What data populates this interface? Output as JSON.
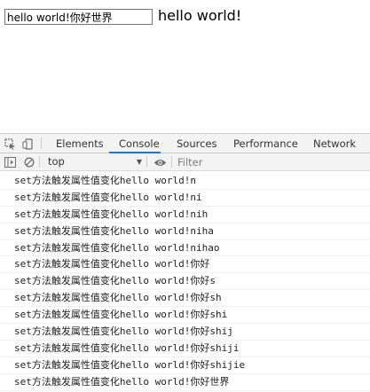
{
  "page": {
    "input_value": "hello world!你好世界",
    "echo_text": "hello world!"
  },
  "devtools": {
    "tabs": [
      {
        "label": "Elements",
        "active": false
      },
      {
        "label": "Console",
        "active": true
      },
      {
        "label": "Sources",
        "active": false
      },
      {
        "label": "Performance",
        "active": false
      },
      {
        "label": "Network",
        "active": false
      }
    ],
    "toolbar": {
      "context": "top",
      "filter_placeholder": "Filter"
    },
    "console_lines": [
      "set方法触发属性值变化hello world!n",
      "set方法触发属性值变化hello world!ni",
      "set方法触发属性值变化hello world!nih",
      "set方法触发属性值变化hello world!niha",
      "set方法触发属性值变化hello world!nihao",
      "set方法触发属性值变化hello world!你好",
      "set方法触发属性值变化hello world!你好s",
      "set方法触发属性值变化hello world!你好sh",
      "set方法触发属性值变化hello world!你好shi",
      "set方法触发属性值变化hello world!你好shij",
      "set方法触发属性值变化hello world!你好shiji",
      "set方法触发属性值变化hello world!你好shijie",
      "set方法触发属性值变化hello world!你好世界"
    ],
    "colors": {
      "accent": "#1a73e8",
      "toolbar_bg": "#f3f3f3",
      "border": "#cccccc"
    },
    "icons": [
      "inspect-element-icon",
      "device-toolbar-icon",
      "sidebar-toggle-icon",
      "clear-console-icon",
      "eye-icon"
    ]
  }
}
